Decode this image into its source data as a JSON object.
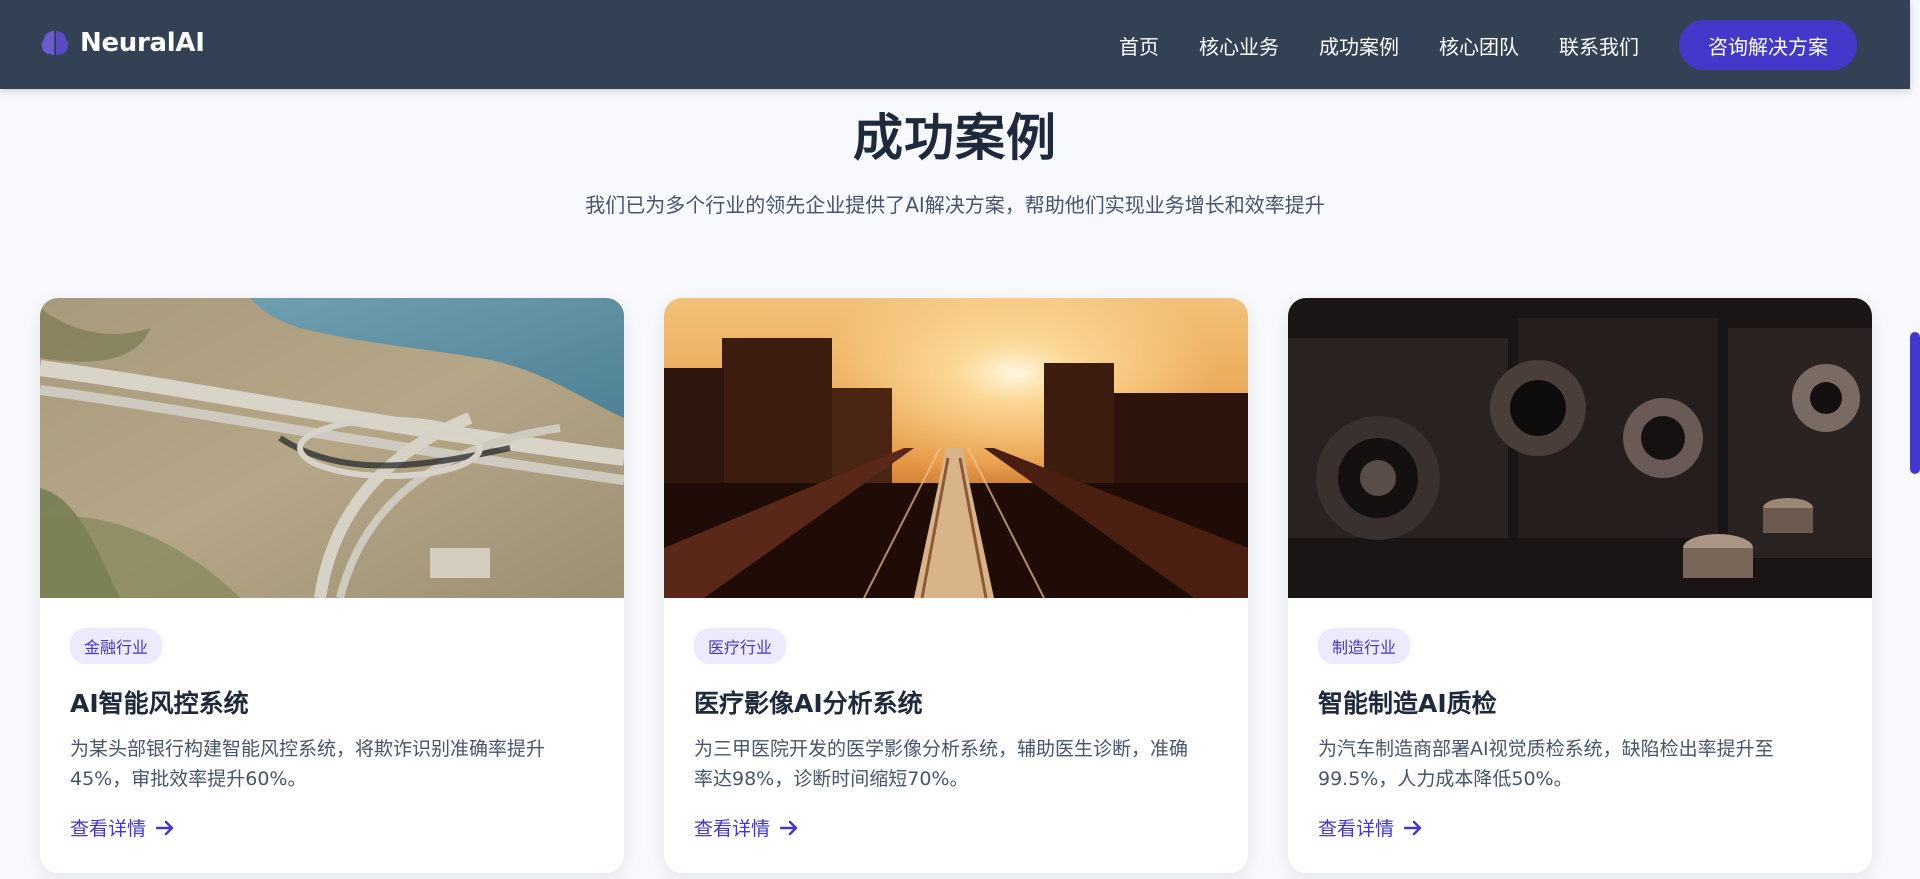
{
  "nav": {
    "brand": "NeuralAI",
    "brand_icon": "brain-icon",
    "links": [
      "首页",
      "核心业务",
      "成功案例",
      "核心团队",
      "联系我们"
    ],
    "cta_label": "咨询解决方案"
  },
  "section": {
    "title": "成功案例",
    "subtitle": "我们已为多个行业的领先企业提供了AI解决方案，帮助他们实现业务增长和效率提升"
  },
  "cards": [
    {
      "tag": "金融行业",
      "title": "AI智能风控系统",
      "desc_line1": "为某头部银行构建智能风控系统，将欺诈识别准确率提升",
      "desc_line2": "45%，审批效率提升60%。",
      "link_label": "查看详情",
      "image": "aerial-highway-photo"
    },
    {
      "tag": "医疗行业",
      "title": "医疗影像AI分析系统",
      "desc_line1": "为三甲医院开发的医学影像分析系统，辅助医生诊断，准确",
      "desc_line2": "率达98%，诊断时间缩短70%。",
      "link_label": "查看详情",
      "image": "city-sunset-photo"
    },
    {
      "tag": "制造行业",
      "title": "智能制造AI质检",
      "desc_line1": "为汽车制造商部署AI视觉质检系统，缺陷检出率提升至",
      "desc_line2": "99.5%，人力成本降低50%。",
      "link_label": "查看详情",
      "image": "vintage-cameras-photo"
    }
  ],
  "colors": {
    "navbar": "#334155",
    "accent": "#4338ca",
    "tag_bg": "#ede9fe",
    "background": "#f7f9fc"
  }
}
